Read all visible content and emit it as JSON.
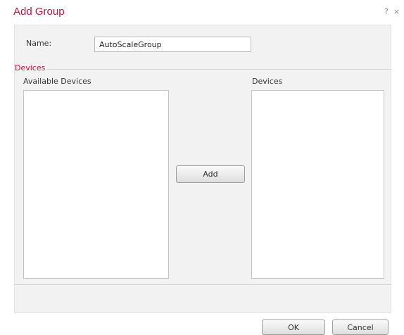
{
  "dialog": {
    "title": "Add Group",
    "help_glyph": "?",
    "close_glyph": "×"
  },
  "form": {
    "name_label": "Name:",
    "name_value": "AutoScaleGroup"
  },
  "devices_section": {
    "legend": "Devices",
    "available_label": "Available Devices",
    "selected_label": "Devices",
    "available_items": [],
    "selected_items": [],
    "add_label": "Add"
  },
  "footer": {
    "ok_label": "OK",
    "cancel_label": "Cancel"
  },
  "colors": {
    "accent": "#c0143c",
    "panel_bg": "#f2f2f2"
  },
  "icons": {
    "help": "help-icon",
    "close": "close-icon"
  }
}
